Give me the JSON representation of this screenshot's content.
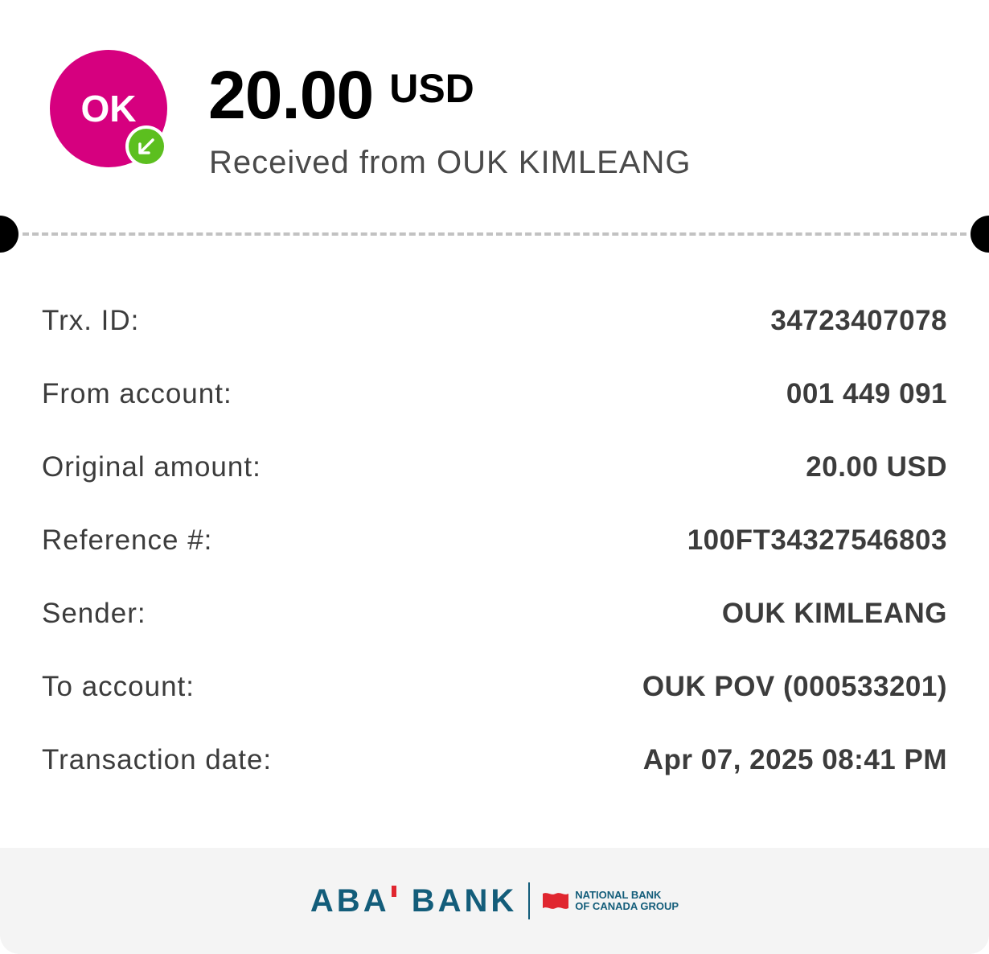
{
  "colors": {
    "avatar_bg": "#d6007f",
    "badge_green": "#5cbf1f",
    "brand_blue": "#135d7a",
    "brand_red": "#e0262f"
  },
  "header": {
    "avatar_initials": "OK",
    "badge_icon": "arrow-down-left-icon",
    "amount": "20.00",
    "currency": "USD",
    "subtitle": "Received from OUK KIMLEANG"
  },
  "details": [
    {
      "label": "Trx. ID:",
      "value": "34723407078"
    },
    {
      "label": "From account:",
      "value": "001 449 091"
    },
    {
      "label": "Original amount:",
      "value": "20.00 USD"
    },
    {
      "label": "Reference #:",
      "value": "100FT34327546803"
    },
    {
      "label": "Sender:",
      "value": "OUK KIMLEANG"
    },
    {
      "label": "To account:",
      "value": "OUK POV (000533201)"
    },
    {
      "label": "Transaction date:",
      "value": "Apr 07, 2025 08:41 PM"
    }
  ],
  "footer": {
    "bank_name_part1": "ABA",
    "bank_name_part2": "BANK",
    "partner_line1": "NATIONAL BANK",
    "partner_line2": "OF CANADA GROUP"
  }
}
